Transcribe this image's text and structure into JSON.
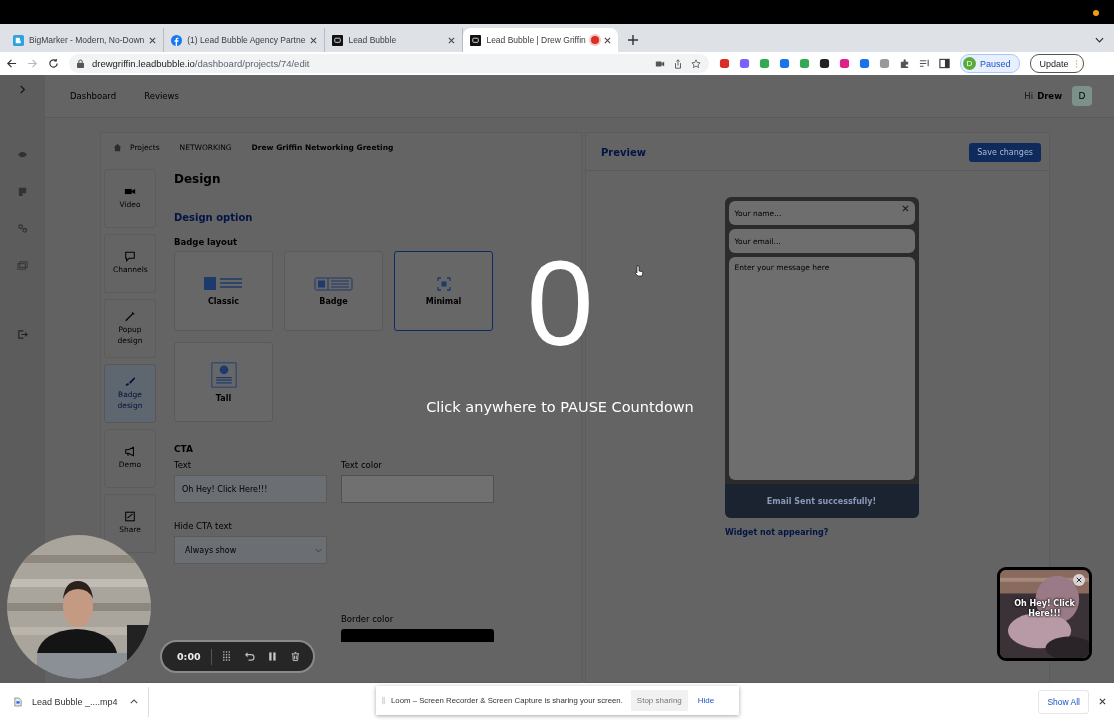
{
  "browser": {
    "tabs": [
      {
        "title": "BigMarker - Modern, No-Down",
        "kind": "bigmarker",
        "selected": false,
        "recording": false
      },
      {
        "title": "(1) Lead Bubble Agency Partne",
        "kind": "facebook",
        "selected": false,
        "recording": false
      },
      {
        "title": "Lead Bubble",
        "kind": "leadbubble",
        "selected": false,
        "recording": false
      },
      {
        "title": "Lead Bubble | Drew Griffin",
        "kind": "leadbubble",
        "selected": true,
        "recording": true
      }
    ],
    "url_host": "drewgriffin.leadbubble.io",
    "url_path": "/dashboard/projects/74/edit",
    "profile": {
      "initial": "D",
      "status": "Paused"
    },
    "update_button": "Update"
  },
  "app": {
    "nav": [
      "Dashboard",
      "Reviews"
    ],
    "greeting": "Hi",
    "user": "Drew",
    "avatar": "D",
    "breadcrumb": [
      "Projects",
      "NETWORKING",
      "Drew Griffin Networking Greeting"
    ],
    "steps": [
      {
        "label": "Video",
        "kind": "video",
        "selected": false
      },
      {
        "label": "Channels",
        "kind": "channels",
        "selected": false
      },
      {
        "label": "Popup design",
        "kind": "popup",
        "selected": false
      },
      {
        "label": "Badge design",
        "kind": "badge",
        "selected": true
      },
      {
        "label": "Demo",
        "kind": "demo",
        "selected": false
      },
      {
        "label": "Share",
        "kind": "share",
        "selected": false
      }
    ],
    "design": {
      "title": "Design",
      "option_title": "Design option",
      "layout_label": "Badge layout",
      "layouts": [
        {
          "label": "Classic",
          "kind": "classic",
          "selected": false
        },
        {
          "label": "Badge",
          "kind": "badge",
          "selected": false
        },
        {
          "label": "Minimal",
          "kind": "minimal",
          "selected": true
        },
        {
          "label": "Tall",
          "kind": "tall",
          "selected": false
        }
      ],
      "cta": {
        "title": "CTA",
        "text_label": "Text",
        "text_value": "Oh Hey! Click Here!!!",
        "text_color_label": "Text color",
        "hide_label": "Hide CTA text",
        "hide_value": "Always show",
        "border_color_label": "Border color"
      }
    },
    "preview": {
      "title": "Preview",
      "save_button": "Save changes",
      "name_placeholder": "Your name...",
      "email_placeholder": "Your email...",
      "message_placeholder": "Enter your message here",
      "status": "Email Sent successfully!",
      "help_link": "Widget not appearing?"
    }
  },
  "countdown": {
    "number": "0",
    "hint": "Click anywhere to PAUSE Countdown"
  },
  "recorder": {
    "time": "0:00"
  },
  "bubble": {
    "text": "Oh Hey! Click Here!!!"
  },
  "downloads": {
    "file": "Lead Bubble _....mp4",
    "show_all": "Show All"
  },
  "sharing_notice": {
    "message": "Loom – Screen Recorder & Screen Capture is sharing your screen.",
    "stop_button": "Stop sharing",
    "hide_button": "Hide"
  }
}
